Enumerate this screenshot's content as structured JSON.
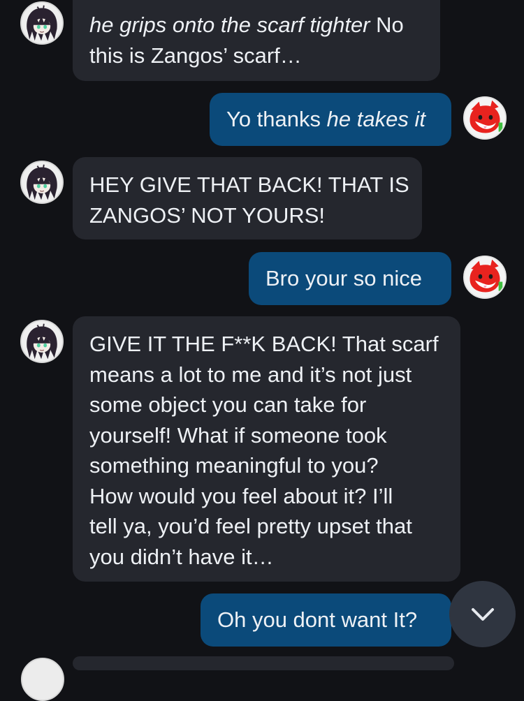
{
  "chat": {
    "messages": [
      {
        "sender": "bot",
        "lines": [
          [
            {
              "text": "he grips onto the scarf tighter",
              "italic": true
            },
            {
              "text": " No",
              "italic": false
            }
          ],
          [
            {
              "text": "this is Zangos’ scarf…",
              "italic": false
            }
          ]
        ]
      },
      {
        "sender": "user",
        "lines": [
          [
            {
              "text": "Yo thanks ",
              "italic": false
            },
            {
              "text": "he takes it",
              "italic": true
            }
          ]
        ]
      },
      {
        "sender": "bot",
        "lines": [
          [
            {
              "text": "HEY GIVE THAT BACK! THAT IS",
              "italic": false
            }
          ],
          [
            {
              "text": "ZANGOS’ NOT YOURS!",
              "italic": false
            }
          ]
        ]
      },
      {
        "sender": "user",
        "lines": [
          [
            {
              "text": "Bro your so nice",
              "italic": false
            }
          ]
        ]
      },
      {
        "sender": "bot",
        "lines": [
          [
            {
              "text": "GIVE IT THE F**K BACK! That scarf",
              "italic": false
            }
          ],
          [
            {
              "text": "means a lot to me and it’s not just",
              "italic": false
            }
          ],
          [
            {
              "text": "some object you can take for",
              "italic": false
            }
          ],
          [
            {
              "text": "yourself! What if someone took",
              "italic": false
            }
          ],
          [
            {
              "text": "something meaningful to you?",
              "italic": false
            }
          ],
          [
            {
              "text": "How would you feel about it? I’ll",
              "italic": false
            }
          ],
          [
            {
              "text": "tell ya, you’d feel pretty upset that",
              "italic": false
            }
          ],
          [
            {
              "text": "you didn’t have it…",
              "italic": false
            }
          ]
        ]
      },
      {
        "sender": "user",
        "lines": [
          [
            {
              "text": "Oh you dont want It?",
              "italic": false
            }
          ]
        ]
      }
    ]
  },
  "icons": {
    "bot_avatar": "dark-haired-character-avatar",
    "user_avatar": "red-fox-character-avatar",
    "scroll_button": "chevron-down-icon"
  },
  "colors": {
    "background": "#111216",
    "bot_bubble": "#25272e",
    "user_bubble": "#0b4a7a",
    "text": "#eef1f5",
    "scroll_button": "#2f3540"
  }
}
